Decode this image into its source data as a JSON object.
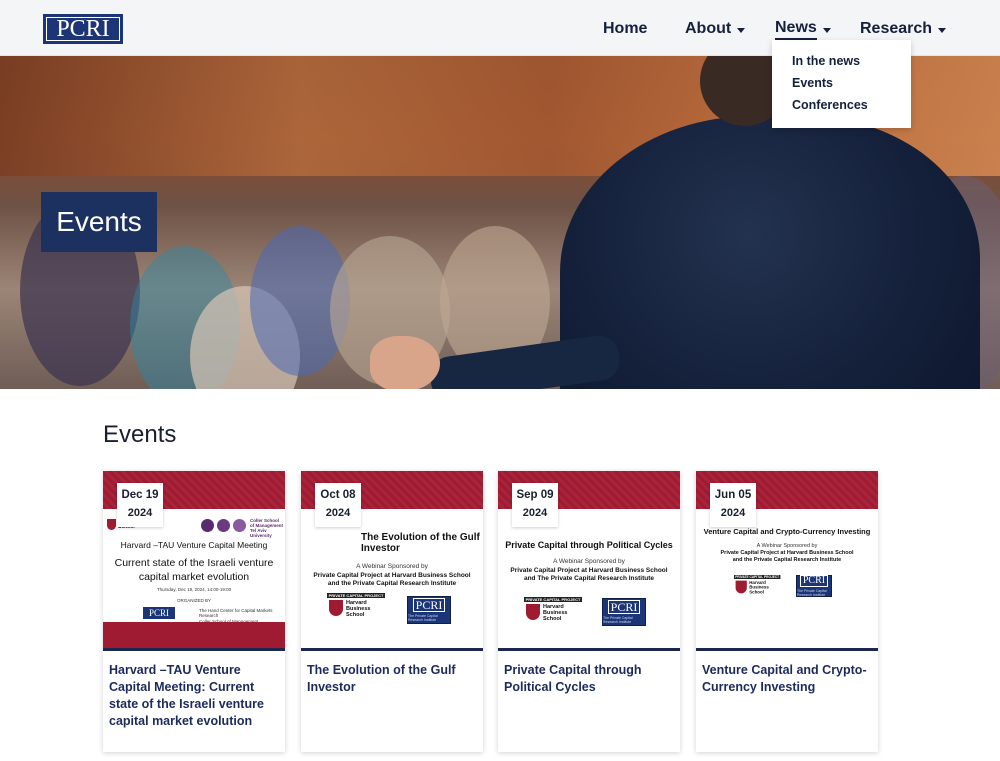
{
  "header": {
    "logo_text": "PCRI",
    "nav": {
      "home": "Home",
      "about": "About",
      "news": "News",
      "research": "Research"
    },
    "news_dropdown": [
      "In the news",
      "Events",
      "Conferences"
    ]
  },
  "hero": {
    "title": "Events"
  },
  "section": {
    "title": "Events"
  },
  "cards": [
    {
      "day": "Dec 19",
      "year": "2024",
      "poster": {
        "hbs": "Business School",
        "coller": "Coller School of Management",
        "coller_sub": "Tel Aviv University",
        "subtitle": "Harvard –TAU Venture Capital Meeting",
        "title": "Current state of the Israeli venture capital market evolution",
        "when": "Thursday, Dec 19, 2024, 14:00-19:00",
        "organized": "ORGANIZED BY",
        "pcri": "PCRI",
        "org1": "The Hand Center for Capital Markets Research",
        "org2": "Coller School of Management"
      },
      "caption": "Harvard –TAU Venture Capital Meeting: Current state of the Israeli venture capital market evolution"
    },
    {
      "day": "Oct 08",
      "year": "2024",
      "poster": {
        "title": "The Evolution of the Gulf Investor",
        "sponsor": "A Webinar Sponsored by",
        "line1": "Private Capital Project at Harvard Business School",
        "line2": "and the Private Capital Research Institute",
        "hbs_bar": "PRIVATE CAPITAL PROJECT",
        "hbs": "Harvard Business School",
        "pcri": "PCRI",
        "pcri_sub": "The Private Capital Research Institute"
      },
      "caption": "The Evolution of the Gulf Investor"
    },
    {
      "day": "Sep 09",
      "year": "2024",
      "poster": {
        "title": "Private Capital through Political Cycles",
        "sponsor": "A Webinar Sponsored by",
        "line1": "Private Capital Project at Harvard Business School",
        "line2": "and The Private Capital Research Institute",
        "hbs_bar": "PRIVATE CAPITAL PROJECT",
        "hbs": "Harvard Business School",
        "pcri": "PCRI",
        "pcri_sub": "The Private Capital Research Institute"
      },
      "caption": "Private Capital through Political Cycles"
    },
    {
      "day": "Jun 05",
      "year": "2024",
      "poster": {
        "title": "Venture Capital and Crypto-Currency Investing",
        "sponsor": "A Webinar Sponsored by",
        "line1": "Private Capital Project at Harvard Business School",
        "line2": "and the Private Capital Research Institute",
        "hbs_bar": "PRIVATE CAPITAL PROJECT",
        "hbs": "Harvard Business School",
        "pcri": "PCRI",
        "pcri_sub": "The Private Capital Research Institute"
      },
      "caption": "Venture Capital and Crypto-Currency Investing"
    }
  ],
  "colors": {
    "navy": "#1c3160",
    "brand_blue": "#1c3577",
    "crimson": "#9e1b32",
    "caption_text": "#1c2a5c"
  }
}
